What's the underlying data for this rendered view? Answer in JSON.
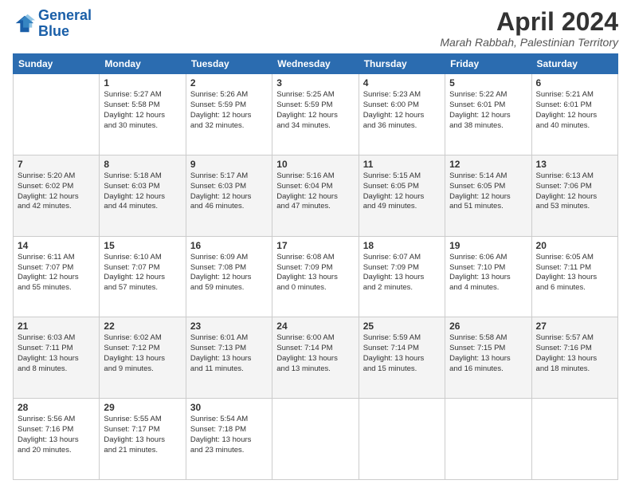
{
  "header": {
    "logo_line1": "General",
    "logo_line2": "Blue",
    "month_title": "April 2024",
    "subtitle": "Marah Rabbah, Palestinian Territory"
  },
  "columns": [
    "Sunday",
    "Monday",
    "Tuesday",
    "Wednesday",
    "Thursday",
    "Friday",
    "Saturday"
  ],
  "weeks": [
    [
      {
        "day": "",
        "info": ""
      },
      {
        "day": "1",
        "info": "Sunrise: 5:27 AM\nSunset: 5:58 PM\nDaylight: 12 hours\nand 30 minutes."
      },
      {
        "day": "2",
        "info": "Sunrise: 5:26 AM\nSunset: 5:59 PM\nDaylight: 12 hours\nand 32 minutes."
      },
      {
        "day": "3",
        "info": "Sunrise: 5:25 AM\nSunset: 5:59 PM\nDaylight: 12 hours\nand 34 minutes."
      },
      {
        "day": "4",
        "info": "Sunrise: 5:23 AM\nSunset: 6:00 PM\nDaylight: 12 hours\nand 36 minutes."
      },
      {
        "day": "5",
        "info": "Sunrise: 5:22 AM\nSunset: 6:01 PM\nDaylight: 12 hours\nand 38 minutes."
      },
      {
        "day": "6",
        "info": "Sunrise: 5:21 AM\nSunset: 6:01 PM\nDaylight: 12 hours\nand 40 minutes."
      }
    ],
    [
      {
        "day": "7",
        "info": "Sunrise: 5:20 AM\nSunset: 6:02 PM\nDaylight: 12 hours\nand 42 minutes."
      },
      {
        "day": "8",
        "info": "Sunrise: 5:18 AM\nSunset: 6:03 PM\nDaylight: 12 hours\nand 44 minutes."
      },
      {
        "day": "9",
        "info": "Sunrise: 5:17 AM\nSunset: 6:03 PM\nDaylight: 12 hours\nand 46 minutes."
      },
      {
        "day": "10",
        "info": "Sunrise: 5:16 AM\nSunset: 6:04 PM\nDaylight: 12 hours\nand 47 minutes."
      },
      {
        "day": "11",
        "info": "Sunrise: 5:15 AM\nSunset: 6:05 PM\nDaylight: 12 hours\nand 49 minutes."
      },
      {
        "day": "12",
        "info": "Sunrise: 5:14 AM\nSunset: 6:05 PM\nDaylight: 12 hours\nand 51 minutes."
      },
      {
        "day": "13",
        "info": "Sunrise: 6:13 AM\nSunset: 7:06 PM\nDaylight: 12 hours\nand 53 minutes."
      }
    ],
    [
      {
        "day": "14",
        "info": "Sunrise: 6:11 AM\nSunset: 7:07 PM\nDaylight: 12 hours\nand 55 minutes."
      },
      {
        "day": "15",
        "info": "Sunrise: 6:10 AM\nSunset: 7:07 PM\nDaylight: 12 hours\nand 57 minutes."
      },
      {
        "day": "16",
        "info": "Sunrise: 6:09 AM\nSunset: 7:08 PM\nDaylight: 12 hours\nand 59 minutes."
      },
      {
        "day": "17",
        "info": "Sunrise: 6:08 AM\nSunset: 7:09 PM\nDaylight: 13 hours\nand 0 minutes."
      },
      {
        "day": "18",
        "info": "Sunrise: 6:07 AM\nSunset: 7:09 PM\nDaylight: 13 hours\nand 2 minutes."
      },
      {
        "day": "19",
        "info": "Sunrise: 6:06 AM\nSunset: 7:10 PM\nDaylight: 13 hours\nand 4 minutes."
      },
      {
        "day": "20",
        "info": "Sunrise: 6:05 AM\nSunset: 7:11 PM\nDaylight: 13 hours\nand 6 minutes."
      }
    ],
    [
      {
        "day": "21",
        "info": "Sunrise: 6:03 AM\nSunset: 7:11 PM\nDaylight: 13 hours\nand 8 minutes."
      },
      {
        "day": "22",
        "info": "Sunrise: 6:02 AM\nSunset: 7:12 PM\nDaylight: 13 hours\nand 9 minutes."
      },
      {
        "day": "23",
        "info": "Sunrise: 6:01 AM\nSunset: 7:13 PM\nDaylight: 13 hours\nand 11 minutes."
      },
      {
        "day": "24",
        "info": "Sunrise: 6:00 AM\nSunset: 7:14 PM\nDaylight: 13 hours\nand 13 minutes."
      },
      {
        "day": "25",
        "info": "Sunrise: 5:59 AM\nSunset: 7:14 PM\nDaylight: 13 hours\nand 15 minutes."
      },
      {
        "day": "26",
        "info": "Sunrise: 5:58 AM\nSunset: 7:15 PM\nDaylight: 13 hours\nand 16 minutes."
      },
      {
        "day": "27",
        "info": "Sunrise: 5:57 AM\nSunset: 7:16 PM\nDaylight: 13 hours\nand 18 minutes."
      }
    ],
    [
      {
        "day": "28",
        "info": "Sunrise: 5:56 AM\nSunset: 7:16 PM\nDaylight: 13 hours\nand 20 minutes."
      },
      {
        "day": "29",
        "info": "Sunrise: 5:55 AM\nSunset: 7:17 PM\nDaylight: 13 hours\nand 21 minutes."
      },
      {
        "day": "30",
        "info": "Sunrise: 5:54 AM\nSunset: 7:18 PM\nDaylight: 13 hours\nand 23 minutes."
      },
      {
        "day": "",
        "info": ""
      },
      {
        "day": "",
        "info": ""
      },
      {
        "day": "",
        "info": ""
      },
      {
        "day": "",
        "info": ""
      }
    ]
  ]
}
